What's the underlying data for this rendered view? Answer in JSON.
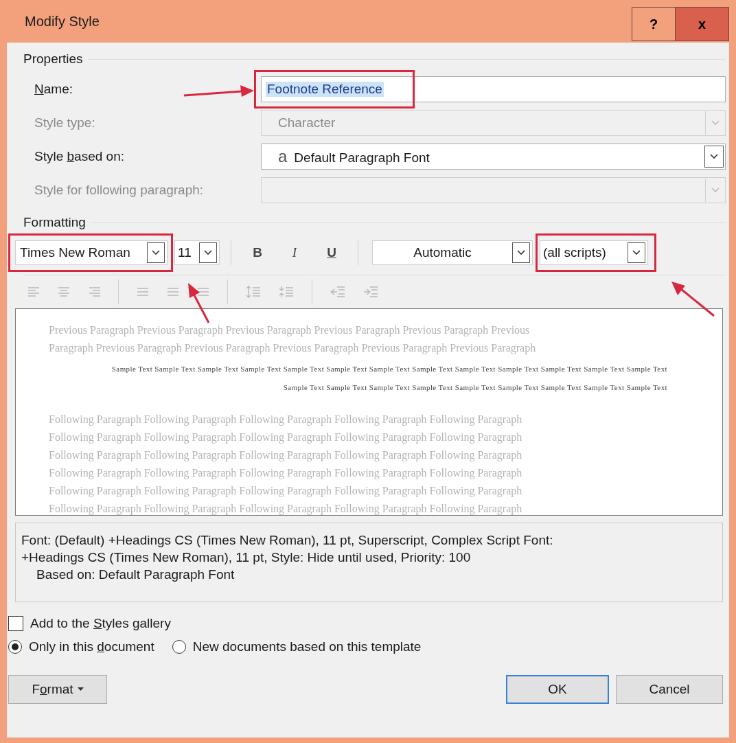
{
  "window": {
    "title": "Modify Style",
    "help_button": "?",
    "close_button": "x"
  },
  "properties": {
    "heading": "Properties",
    "rows": [
      {
        "kind": "text",
        "label": {
          "key": "N",
          "post": "ame:"
        },
        "disabled": false,
        "value": "Footnote Reference",
        "value_selected": true,
        "highlighted": true
      },
      {
        "kind": "dropdown",
        "label": {
          "pre": "Style type:"
        },
        "disabled": true,
        "value": "Character"
      },
      {
        "kind": "dropdown",
        "label": {
          "pre": "Style ",
          "key": "b",
          "post": "ased on:"
        },
        "disabled": false,
        "value": "Default Paragraph Font",
        "value_icon": "a"
      },
      {
        "kind": "dropdown",
        "label": {
          "pre": "Style for following paragraph:"
        },
        "disabled": true
      }
    ]
  },
  "formatting": {
    "heading": "Formatting",
    "font": {
      "value": "Times New Roman",
      "highlighted": true
    },
    "size": {
      "value": "11"
    },
    "styles": [
      "B",
      "I",
      "U"
    ],
    "color": {
      "value": "Automatic"
    },
    "script": {
      "value": "(all scripts)",
      "highlighted": true
    }
  },
  "preview": {
    "previous": [
      "Previous Paragraph Previous Paragraph Previous Paragraph Previous Paragraph Previous Paragraph Previous",
      "Paragraph Previous Paragraph Previous Paragraph Previous Paragraph Previous Paragraph Previous Paragraph"
    ],
    "sample": [
      "Sample Text Sample Text Sample Text Sample Text Sample Text Sample Text Sample Text Sample Text Sample Text Sample Text Sample Text Sample Text Sample Text",
      "Sample Text Sample Text Sample Text Sample Text Sample Text Sample Text Sample Text Sample Text Sample Text"
    ],
    "following": [
      "Following Paragraph Following Paragraph Following Paragraph Following Paragraph Following Paragraph",
      "Following Paragraph Following Paragraph Following Paragraph Following Paragraph Following Paragraph",
      "Following Paragraph Following Paragraph Following Paragraph Following Paragraph Following Paragraph",
      "Following Paragraph Following Paragraph Following Paragraph Following Paragraph Following Paragraph",
      "Following Paragraph Following Paragraph Following Paragraph Following Paragraph Following Paragraph",
      "Following Paragraph Following Paragraph Following Paragraph Following Paragraph Following Paragraph"
    ]
  },
  "description": [
    "Font: (Default) +Headings CS (Times New Roman), 11 pt, Superscript, Complex Script Font:",
    "+Headings CS (Times New Roman), 11 pt, Style: Hide until used, Priority: 100",
    "Based on: Default Paragraph Font"
  ],
  "add_to_gallery": {
    "label": {
      "pre": "Add to the ",
      "key": "S",
      "post": "tyles gallery"
    },
    "checked": false
  },
  "scope": [
    {
      "label": {
        "pre": "Only in this ",
        "key": "d",
        "post": "ocument"
      },
      "selected": true
    },
    {
      "label": {
        "pre": "New documents based on this template"
      },
      "selected": false
    }
  ],
  "buttons": [
    {
      "kind": "menu",
      "label": {
        "pre": "F",
        "key": "o",
        "post": "rmat"
      }
    },
    {
      "kind": "default",
      "label": {
        "pre": "OK"
      }
    },
    {
      "kind": "plain",
      "label": {
        "pre": "Cancel"
      }
    }
  ]
}
